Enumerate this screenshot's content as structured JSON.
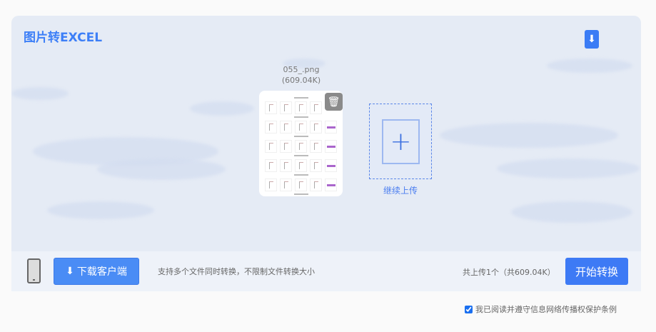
{
  "header": {
    "title": "图片转EXCEL"
  },
  "file": {
    "name": "055_.png",
    "size": "(609.04K)"
  },
  "upload": {
    "add_label": "继续上传"
  },
  "bar": {
    "client_button": "下载客户端",
    "hint": "支持多个文件同时转换，不限制文件转换大小",
    "count": "共上传1个（共609.04K）",
    "start_button": "开始转换"
  },
  "agreement": {
    "label": "我已阅读并遵守信息网络传播权保护条例",
    "checked": true
  },
  "colors": {
    "accent": "#3d7af5"
  }
}
